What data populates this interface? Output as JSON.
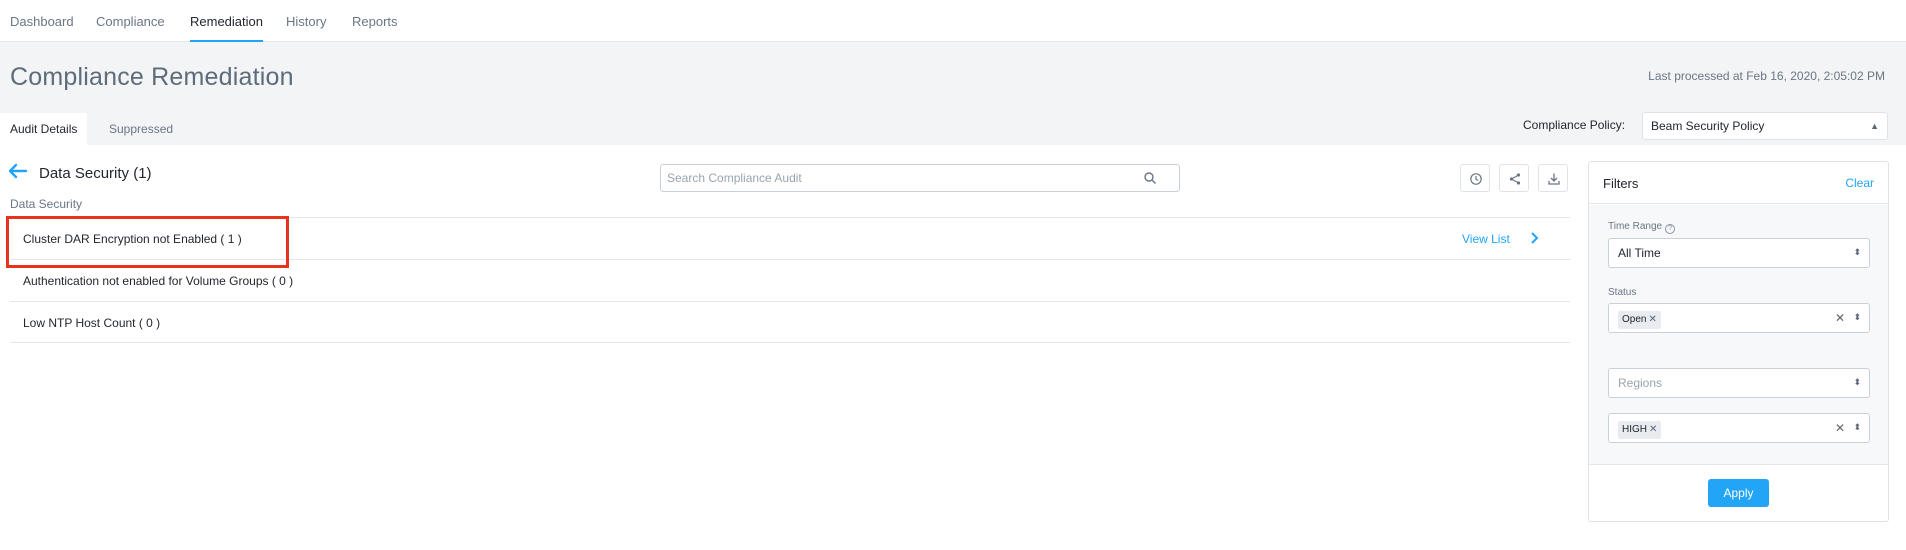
{
  "nav": {
    "tabs": [
      {
        "label": "Dashboard"
      },
      {
        "label": "Compliance"
      },
      {
        "label": "Remediation",
        "active": true
      },
      {
        "label": "History"
      },
      {
        "label": "Reports"
      }
    ]
  },
  "header": {
    "title": "Compliance Remediation",
    "last_processed": "Last processed at Feb 16, 2020, 2:05:02 PM",
    "subtabs": [
      {
        "label": "Audit Details",
        "active": true
      },
      {
        "label": "Suppressed"
      }
    ],
    "policy_label": "Compliance Policy:",
    "policy_value": "Beam Security Policy"
  },
  "main": {
    "section_title": "Data Security (1)",
    "section_subtitle": "Data Security",
    "search_placeholder": "Search Compliance Audit",
    "rows": [
      {
        "label": "Cluster DAR Encryption not Enabled ( 1 )",
        "action": "View List",
        "highlighted": true
      },
      {
        "label": "Authentication not enabled for Volume Groups ( 0 )"
      },
      {
        "label": "Low NTP Host Count ( 0 )"
      }
    ]
  },
  "filters": {
    "title": "Filters",
    "clear_label": "Clear",
    "time_range_label": "Time Range",
    "time_range_value": "All Time",
    "status_label": "Status",
    "status_chip": "Open",
    "regions_placeholder": "Regions",
    "severity_chip": "HIGH",
    "apply_label": "Apply"
  },
  "colors": {
    "accent": "#22a5f7",
    "highlight_box": "#e8321e",
    "header_bg": "#f2f4f6"
  }
}
